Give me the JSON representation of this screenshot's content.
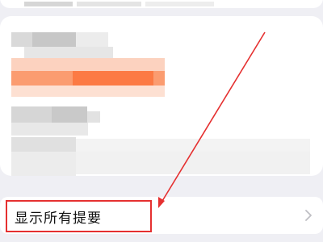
{
  "settings_row": {
    "label": "显示所有提要",
    "chevron_icon": "chevron-right-icon"
  },
  "annotation": {
    "color": "#e53030"
  },
  "accent_color": "#fc7a44"
}
